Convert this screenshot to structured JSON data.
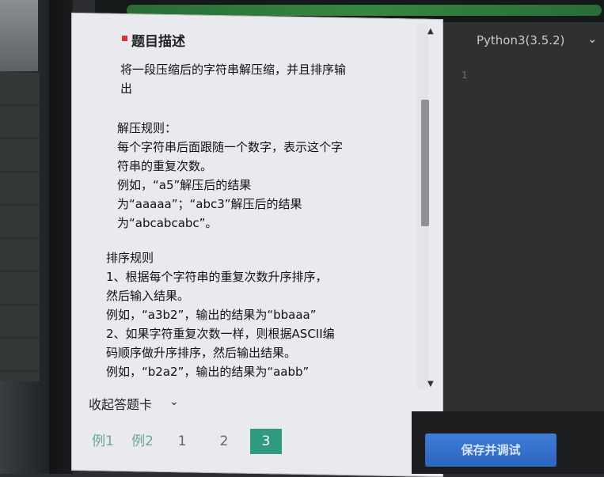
{
  "problem": {
    "title": "题目描述",
    "paragraphs": [
      "将一段压缩后的字符串解压缩，并且排序输\n出",
      "解压规则：\n每个字符串后面跟随一个数字，表示这个字\n符串的重复次数。\n例如，“a5”解压后的结果\n为“aaaaa”；“abc3”解压后的结果\n为“abcabcabc”。",
      "排序规则\n1、根据每个字符串的重复次数升序排序，\n然后输入结果。\n例如，“a3b2”，输出的结果为“bbaaa”\n2、如果字符重复次数一样，则根据ASCII编\n码顺序做升序排序，然后输出结果。\n例如，“b2a2”，输出的结果为“aabb”"
    ]
  },
  "answer_card": {
    "collapse_label": "收起答题卡"
  },
  "tabs": [
    {
      "label": "例1",
      "active": false
    },
    {
      "label": "例2",
      "active": false
    },
    {
      "label": "1",
      "active": false
    },
    {
      "label": "2",
      "active": false
    },
    {
      "label": "3",
      "active": true
    }
  ],
  "editor": {
    "language": "Python3(3.5.2)",
    "line_number": "1"
  },
  "actions": {
    "save_debug_label": "保存并调试"
  },
  "colors": {
    "accent": "#2f9a7e",
    "button": "#2b66bf",
    "title_marker": "#d9352c"
  }
}
